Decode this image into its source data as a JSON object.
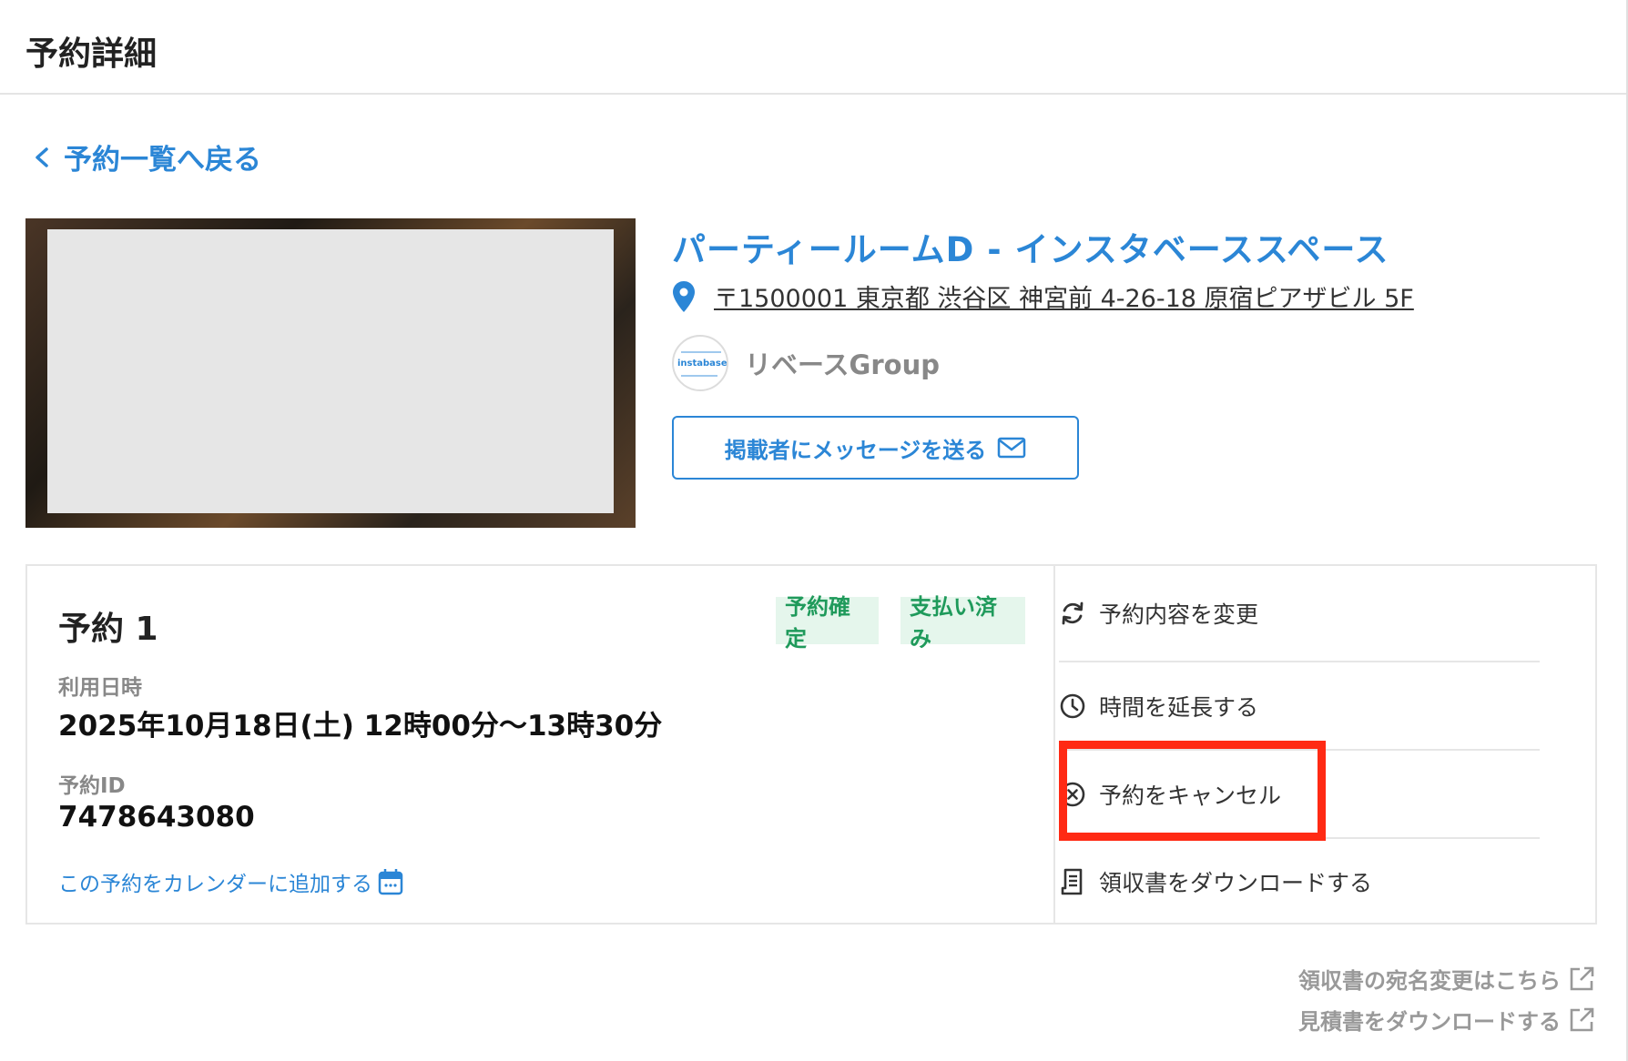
{
  "header": {
    "title": "予約詳細"
  },
  "navigation": {
    "back_label": "予約一覧へ戻る"
  },
  "space": {
    "name": "パーティールームD - インスタベーススペース",
    "address": "〒1500001 東京都 渋谷区 神宮前 4-26-18 原宿ピアザビル 5F",
    "host_name": "リベースGroup",
    "host_logo_text": "instabase",
    "message_button_label": "掲載者にメッセージを送る"
  },
  "reservation": {
    "title": "予約 1",
    "status_badges": [
      "予約確定",
      "支払い済み"
    ],
    "date_label": "利用日時",
    "date_value": "2025年10月18日(土) 12時00分〜13時30分",
    "id_label": "予約ID",
    "id_value": "7478643080",
    "calendar_link": "この予約をカレンダーに追加する"
  },
  "actions": [
    {
      "label": "予約内容を変更",
      "icon": "refresh-icon"
    },
    {
      "label": "時間を延長する",
      "icon": "clock-icon"
    },
    {
      "label": "予約をキャンセル",
      "icon": "cancel-circle-icon"
    },
    {
      "label": "領収書をダウンロードする",
      "icon": "receipt-icon"
    }
  ],
  "annotation": {
    "highlight_color": "#ff2a14"
  },
  "footer_links": [
    {
      "label": "領収書の宛名変更はこちら",
      "icon": "external-link-icon"
    },
    {
      "label": "見積書をダウンロードする",
      "icon": "external-link-icon"
    }
  ],
  "colors": {
    "accent": "#2b86d6",
    "badge_bg": "#e5f6ec",
    "badge_text": "#1f9a5b"
  }
}
